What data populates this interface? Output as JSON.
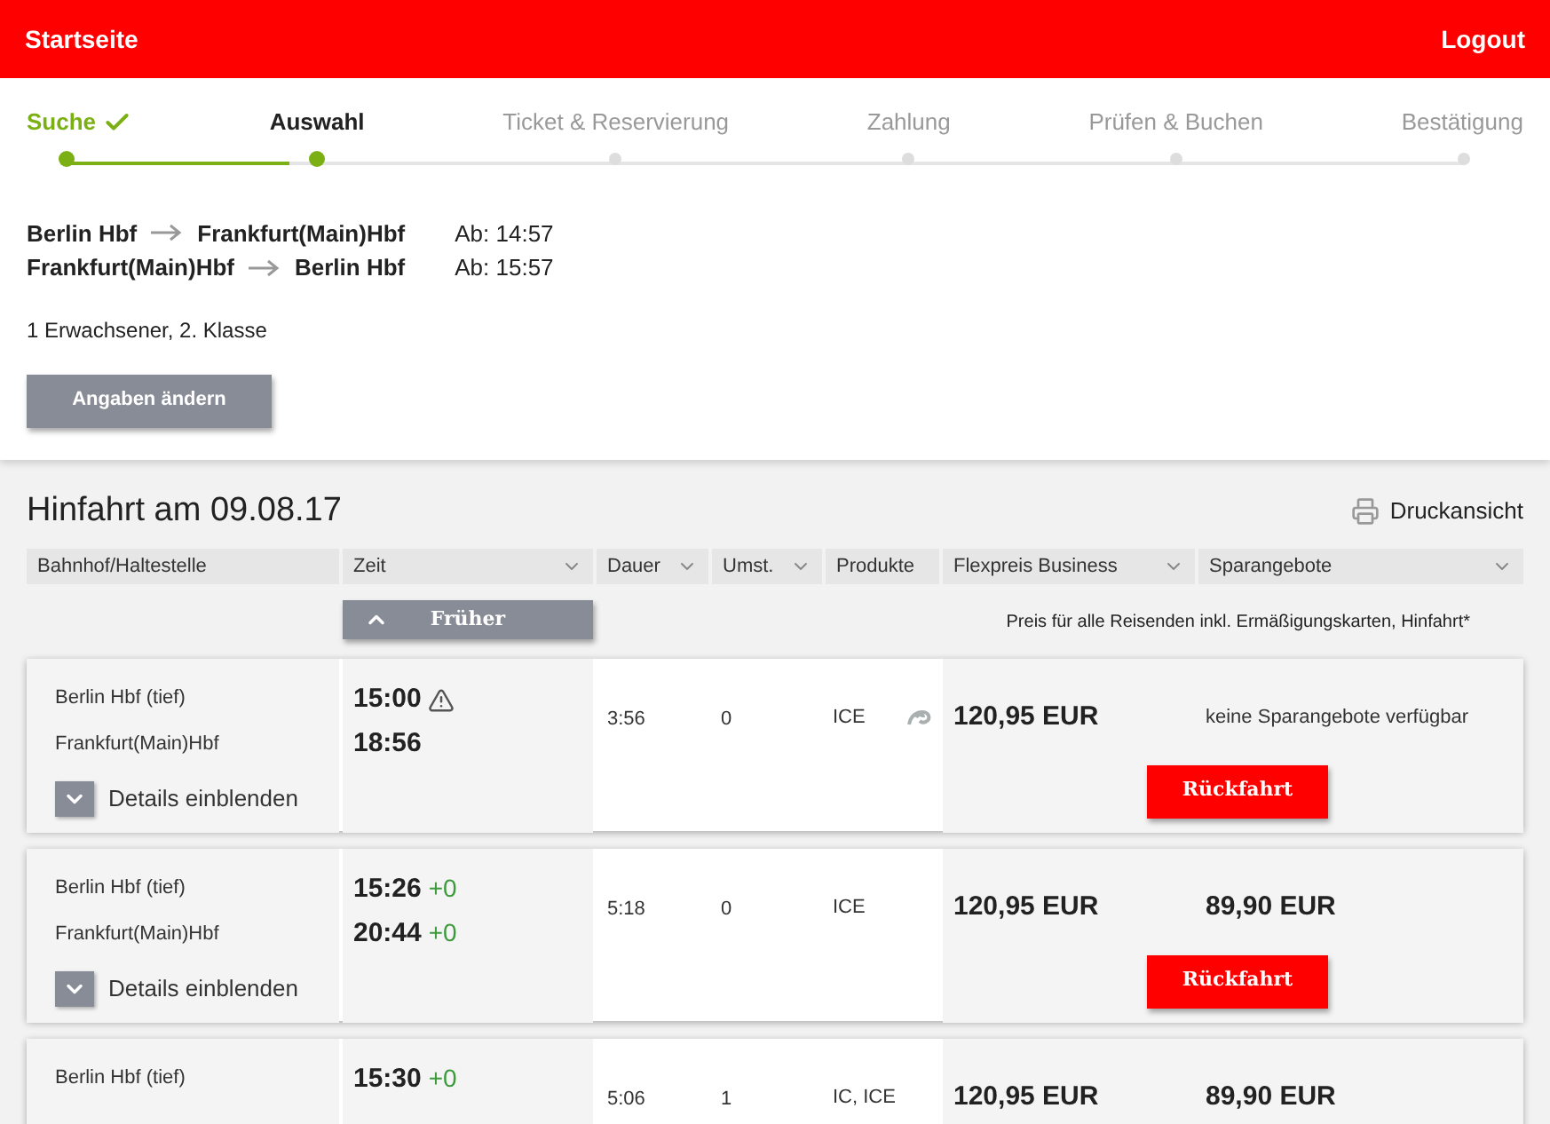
{
  "header": {
    "home": "Startseite",
    "logout": "Logout"
  },
  "steps": [
    {
      "label": "Suche",
      "completed": true,
      "selected": false
    },
    {
      "label": "Auswahl",
      "completed": false,
      "selected": true
    },
    {
      "label": "Ticket & Reservierung",
      "completed": false,
      "selected": false
    },
    {
      "label": "Zahlung",
      "completed": false,
      "selected": false
    },
    {
      "label": "Prüfen & Buchen",
      "completed": false,
      "selected": false
    },
    {
      "label": "Bestätigung",
      "completed": false,
      "selected": false
    }
  ],
  "summary": {
    "routes": [
      {
        "from": "Berlin Hbf",
        "to": "Frankfurt(Main)Hbf",
        "departure": "Ab: 14:57"
      },
      {
        "from": "Frankfurt(Main)Hbf",
        "to": "Berlin Hbf",
        "departure": "Ab: 15:57"
      }
    ],
    "travellers": "1 Erwachsener, 2. Klasse",
    "change_button": "Angaben ändern"
  },
  "results": {
    "title": "Hinfahrt am 09.08.17",
    "print": "Druckansicht",
    "columns": [
      {
        "label": "Bahnhof/Haltestelle",
        "sortable": false
      },
      {
        "label": "Zeit",
        "sortable": true
      },
      {
        "label": "Dauer",
        "sortable": true
      },
      {
        "label": "Umst.",
        "sortable": true
      },
      {
        "label": "Produkte",
        "sortable": false
      },
      {
        "label": "Flexpreis Business",
        "sortable": true
      },
      {
        "label": "Sparangebote",
        "sortable": true
      }
    ],
    "earlier_button": "Früher",
    "price_note": "Preis für alle Reisenden inkl. Ermäßigungskarten, Hinfahrt*",
    "trips": [
      {
        "from": "Berlin Hbf (tief)",
        "to": "Frankfurt(Main)Hbf",
        "departure": "15:00",
        "arrival": "18:56",
        "warning": true,
        "duration": "3:56",
        "changes": "0",
        "products": "ICE",
        "special_icon": true,
        "flex_price": "120,95 EUR",
        "saver_note": "keine Sparangebote verfügbar",
        "details": "Details einblenden",
        "return_button": "Rückfahrt"
      },
      {
        "from": "Berlin Hbf (tief)",
        "to": "Frankfurt(Main)Hbf",
        "departure": "15:26",
        "departure_delay": "+0",
        "arrival": "20:44",
        "arrival_delay": "+0",
        "warning": false,
        "duration": "5:18",
        "changes": "0",
        "products": "ICE",
        "special_icon": false,
        "flex_price": "120,95 EUR",
        "saver_price": "89,90 EUR",
        "details": "Details einblenden",
        "return_button": "Rückfahrt"
      },
      {
        "from": "Berlin Hbf (tief)",
        "departure": "15:30",
        "departure_delay": "+0",
        "warning": false,
        "duration": "5:06",
        "changes": "1",
        "products": "IC, ICE",
        "special_icon": false,
        "flex_price": "120,95 EUR",
        "saver_price": "89,90 EUR"
      }
    ]
  }
}
